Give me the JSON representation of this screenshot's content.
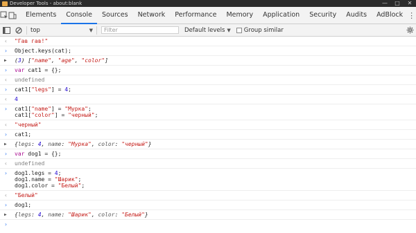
{
  "window": {
    "title": "Developer Tools - about:blank",
    "controls": [
      "—",
      "□",
      "✕"
    ]
  },
  "tabs": [
    "Elements",
    "Console",
    "Sources",
    "Network",
    "Performance",
    "Memory",
    "Application",
    "Security",
    "Audits",
    "AdBlock"
  ],
  "active_tab": "Console",
  "toolbar": {
    "context": "top",
    "filter_placeholder": "Filter",
    "levels": "Default levels",
    "group_similar": "Group similar"
  },
  "console": {
    "entries": [
      {
        "kind": "result",
        "lines": [
          "\"Гав гав!\""
        ]
      },
      {
        "kind": "input",
        "lines": [
          "Object.keys(cat);"
        ]
      },
      {
        "kind": "obj",
        "lines": [
          "(3) [\"name\", \"age\", \"color\"]"
        ]
      },
      {
        "kind": "input",
        "lines": [
          "var cat1 = {};"
        ]
      },
      {
        "kind": "result",
        "lines": [
          "undefined"
        ]
      },
      {
        "kind": "input",
        "lines": [
          "cat1[\"legs\"] = 4;"
        ]
      },
      {
        "kind": "result",
        "lines": [
          "4"
        ]
      },
      {
        "kind": "input",
        "lines": [
          "cat1[\"name\"] = \"Мурка\";",
          "cat1[\"color\"] = \"черный\";"
        ]
      },
      {
        "kind": "result",
        "lines": [
          "\"черный\""
        ]
      },
      {
        "kind": "input",
        "lines": [
          "cat1;"
        ]
      },
      {
        "kind": "obj",
        "lines": [
          "{legs: 4, name: \"Мурка\", color: \"черный\"}"
        ]
      },
      {
        "kind": "input",
        "lines": [
          "var dog1 = {};"
        ]
      },
      {
        "kind": "result",
        "lines": [
          "undefined"
        ]
      },
      {
        "kind": "input",
        "lines": [
          "dog1.legs = 4;",
          "dog1.name = \"Шарик\";",
          "dog1.color = \"Белый\";"
        ]
      },
      {
        "kind": "result",
        "lines": [
          "\"Белый\""
        ]
      },
      {
        "kind": "input",
        "lines": [
          "dog1;"
        ]
      },
      {
        "kind": "obj",
        "lines": [
          "{legs: 4, name: \"Шарик\", color: \"Белый\"}"
        ]
      }
    ]
  },
  "icons": {
    "inspect": "inspect-icon",
    "device": "device-toggle-icon",
    "more": "more-vert-icon",
    "close": "close-icon",
    "sidebar": "sidebar-toggle-icon",
    "clear": "clear-console-icon",
    "settings": "gear-icon"
  },
  "colors": {
    "active_tab_underline": "#1a73e8",
    "prompt": "#367cf1",
    "string": "#c41a16",
    "number": "#1c00cf",
    "keyword": "#aa0d91"
  }
}
